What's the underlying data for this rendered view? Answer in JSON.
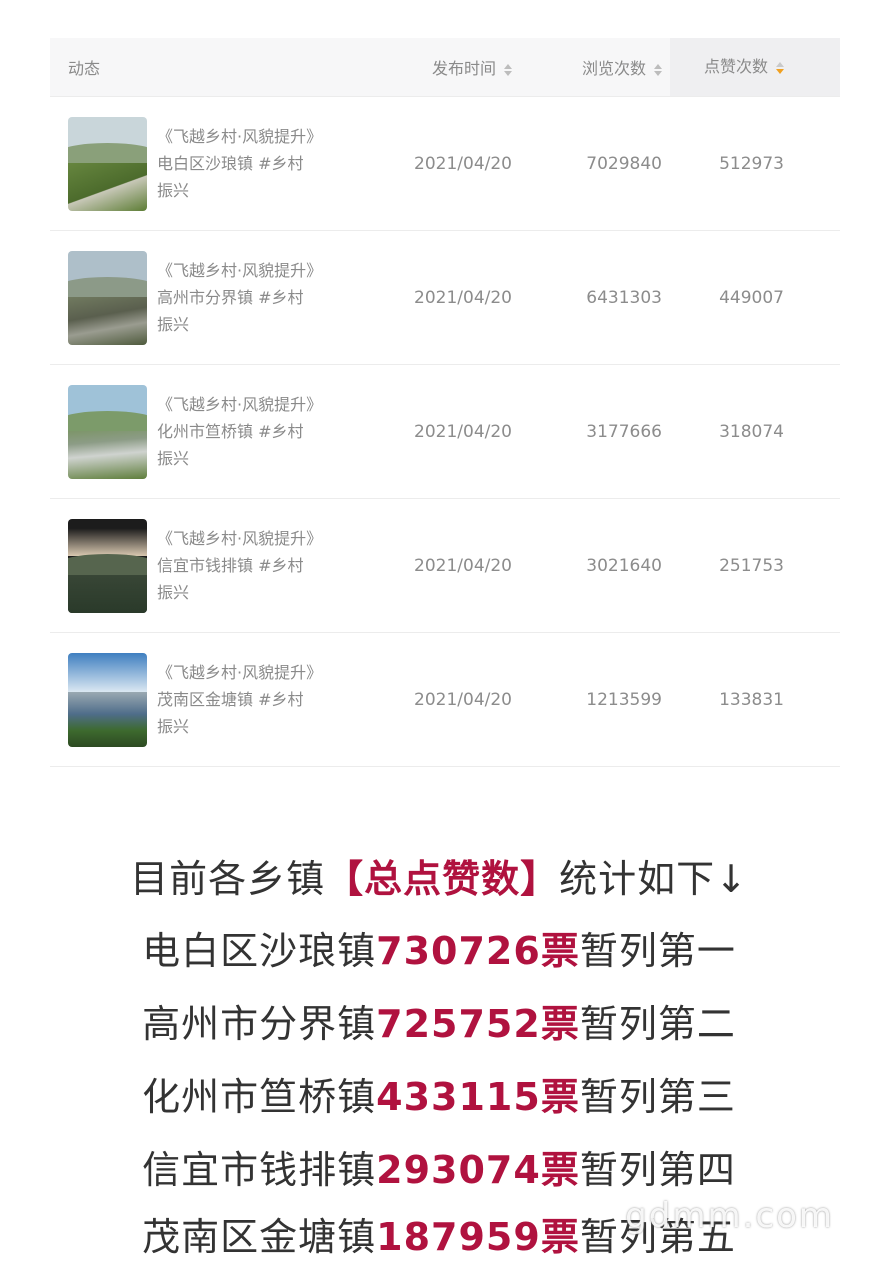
{
  "table": {
    "headers": {
      "feed": "动态",
      "date": "发布时间",
      "views": "浏览次数",
      "likes": "点赞次数"
    },
    "rows": [
      {
        "caption": "《飞越乡村·风貌提升》电白区沙琅镇 #乡村振兴",
        "date": "2021/04/20",
        "views": "7029840",
        "likes": "512973"
      },
      {
        "caption": "《飞越乡村·风貌提升》高州市分界镇 #乡村振兴",
        "date": "2021/04/20",
        "views": "6431303",
        "likes": "449007"
      },
      {
        "caption": "《飞越乡村·风貌提升》化州市笪桥镇 #乡村振兴",
        "date": "2021/04/20",
        "views": "3177666",
        "likes": "318074"
      },
      {
        "caption": "《飞越乡村·风貌提升》信宜市钱排镇 #乡村振兴",
        "date": "2021/04/20",
        "views": "3021640",
        "likes": "251753"
      },
      {
        "caption": "《飞越乡村·风貌提升》茂南区金塘镇 #乡村振兴",
        "date": "2021/04/20",
        "views": "1213599",
        "likes": "133831"
      }
    ]
  },
  "summary": {
    "intro_before": "目前各乡镇",
    "intro_highlight": "【总点赞数】",
    "intro_after": "统计如下↓",
    "lines": [
      {
        "town": "电白区沙琅镇",
        "votes": "730726票",
        "rank": "暂列第一"
      },
      {
        "town": "高州市分界镇",
        "votes": "725752票",
        "rank": "暂列第二"
      },
      {
        "town": "化州市笪桥镇",
        "votes": "433115票",
        "rank": "暂列第三"
      },
      {
        "town": "信宜市钱排镇",
        "votes": "293074票",
        "rank": "暂列第四"
      },
      {
        "town": "茂南区金塘镇",
        "votes": "187959票",
        "rank": "暂列第五"
      }
    ]
  },
  "watermark": "gdmm.com",
  "colors": {
    "highlight": "#b0123f",
    "sort_active": "#f0a020"
  }
}
